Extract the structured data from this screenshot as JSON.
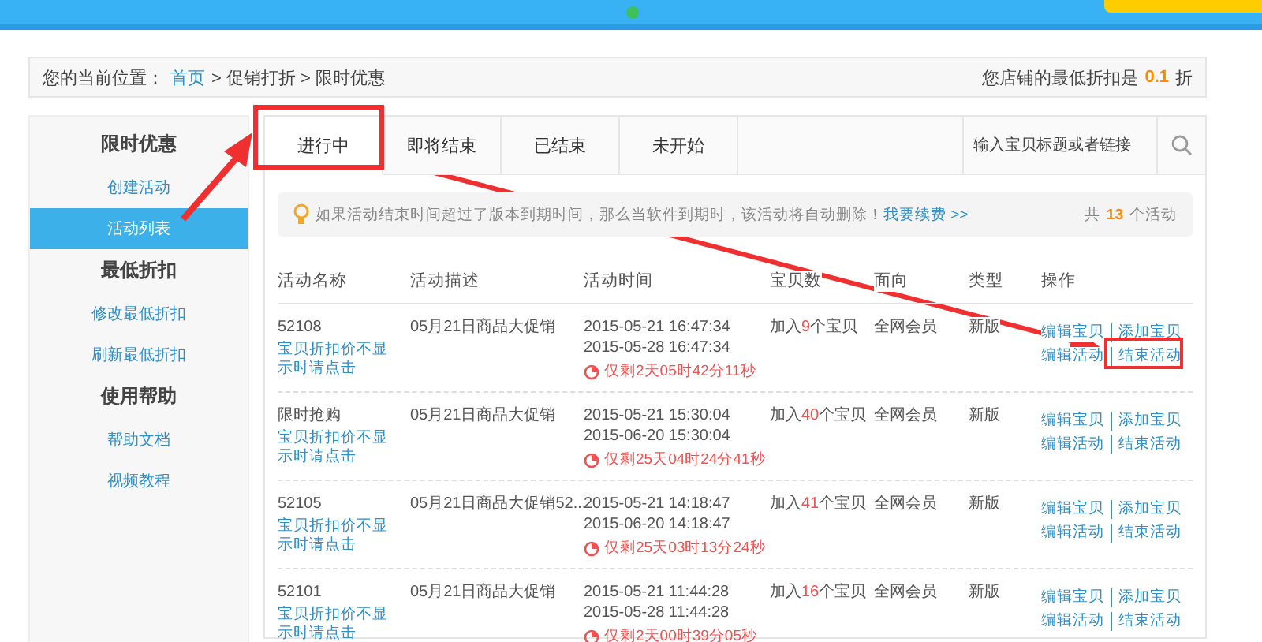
{
  "breadcrumb": {
    "label": "您的当前位置：",
    "home": "首页",
    "trail": "> 促销打折 > 限时优惠",
    "min_discount_label": "您店铺的最低折扣是",
    "min_discount_value": "0.1",
    "min_discount_unit": "折"
  },
  "sidebar": [
    {
      "title": "限时优惠",
      "items": [
        {
          "label": "创建活动",
          "selected": false
        },
        {
          "label": "活动列表",
          "selected": true
        }
      ]
    },
    {
      "title": "最低折扣",
      "items": [
        {
          "label": "修改最低折扣",
          "selected": false
        },
        {
          "label": "刷新最低折扣",
          "selected": false
        }
      ]
    },
    {
      "title": "使用帮助",
      "items": [
        {
          "label": "帮助文档",
          "selected": false
        },
        {
          "label": "视频教程",
          "selected": false
        }
      ]
    }
  ],
  "tabs": [
    {
      "label": "进行中",
      "selected": true
    },
    {
      "label": "即将结束",
      "selected": false
    },
    {
      "label": "已结束",
      "selected": false
    },
    {
      "label": "未开始",
      "selected": false
    }
  ],
  "search": {
    "placeholder": "输入宝贝标题或者链接"
  },
  "notice": {
    "text": "如果活动结束时间超过了版本到期时间，那么当软件到期时，该活动将自动删除！",
    "link": "我要续费 >>",
    "count_prefix": "共",
    "count": "13",
    "count_suffix": "个活动"
  },
  "table": {
    "columns": [
      "活动名称",
      "活动描述",
      "活动时间",
      "宝贝数",
      "面向",
      "类型",
      "操作"
    ],
    "rows": [
      {
        "name": "52108",
        "note": "宝贝折扣价不显示时请点击",
        "desc": "05月21日商品大促销",
        "start": "2015-05-21 16:47:34",
        "end": "2015-05-28 16:47:34",
        "remaining": "仅剩2天05时42分11秒",
        "count_prefix": "加入",
        "count": "9",
        "count_suffix": "个宝贝",
        "target": "全网会员",
        "type": "新版",
        "actions": [
          "编辑宝贝",
          "添加宝贝",
          "编辑活动",
          "结束活动"
        ]
      },
      {
        "name": "限时抢购",
        "note": "宝贝折扣价不显示时请点击",
        "desc": "05月21日商品大促销",
        "start": "2015-05-21 15:30:04",
        "end": "2015-06-20 15:30:04",
        "remaining": "仅剩25天04时24分41秒",
        "count_prefix": "加入",
        "count": "40",
        "count_suffix": "个宝贝",
        "target": "全网会员",
        "type": "新版",
        "actions": [
          "编辑宝贝",
          "添加宝贝",
          "编辑活动",
          "结束活动"
        ]
      },
      {
        "name": "52105",
        "note": "宝贝折扣价不显示时请点击",
        "desc": "05月21日商品大促销52...",
        "start": "2015-05-21 14:18:47",
        "end": "2015-06-20 14:18:47",
        "remaining": "仅剩25天03时13分24秒",
        "count_prefix": "加入",
        "count": "41",
        "count_suffix": "个宝贝",
        "target": "全网会员",
        "type": "新版",
        "actions": [
          "编辑宝贝",
          "添加宝贝",
          "编辑活动",
          "结束活动"
        ]
      },
      {
        "name": "52101",
        "note": "宝贝折扣价不显示时请点击",
        "desc": "05月21日商品大促销",
        "start": "2015-05-21 11:44:28",
        "end": "2015-05-28 11:44:28",
        "remaining": "仅剩2天00时39分05秒",
        "count_prefix": "加入",
        "count": "16",
        "count_suffix": "个宝贝",
        "target": "全网会员",
        "type": "新版",
        "actions": [
          "编辑宝贝",
          "添加宝贝",
          "编辑活动",
          "结束活动"
        ]
      }
    ]
  }
}
